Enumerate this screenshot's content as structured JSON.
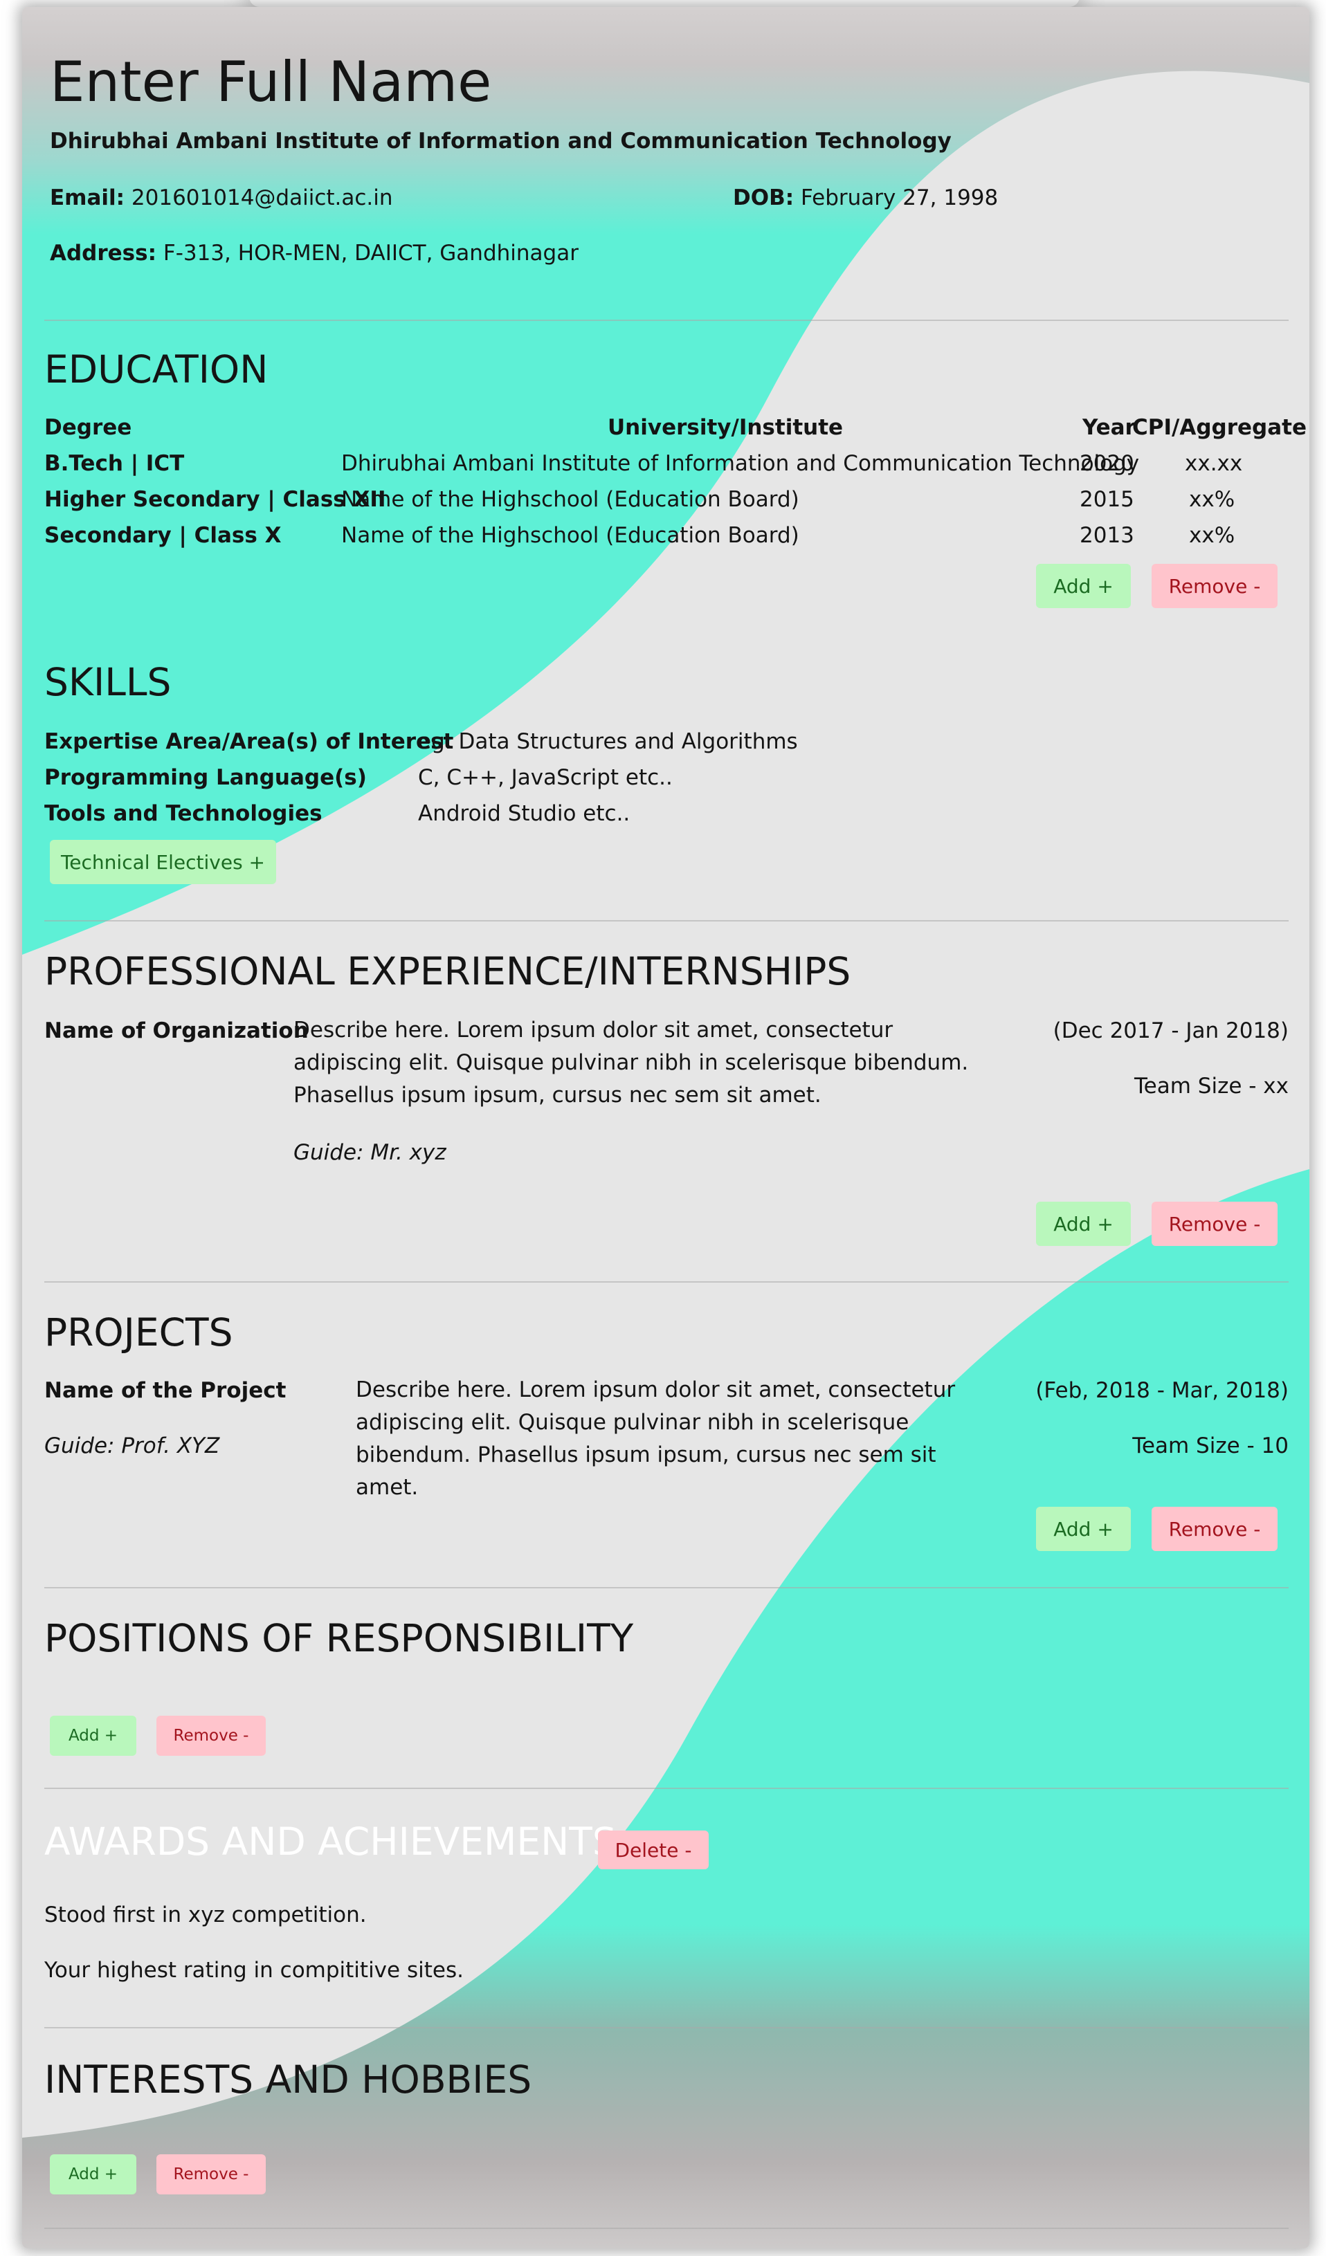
{
  "header": {
    "name": "Enter Full Name",
    "institute": "Dhirubhai Ambani Institute of Information and Communication Technology",
    "email_label": "Email:",
    "email": "201601014@daiict.ac.in",
    "dob_label": "DOB:",
    "dob": "February 27, 1998",
    "address_label": "Address:",
    "address": "F-313, HOR-MEN, DAIICT, Gandhinagar"
  },
  "education": {
    "title": "EDUCATION",
    "headers": [
      "Degree",
      "University/Institute",
      "Year",
      "CPI/Aggregate"
    ],
    "rows": [
      {
        "degree": "B.Tech | ICT",
        "institute": "Dhirubhai Ambani Institute of Information and Communication Technology",
        "year": "2020",
        "score": "xx.xx"
      },
      {
        "degree": "Higher Secondary | Class XII",
        "institute": "Name of the Highschool (Education Board)",
        "year": "2015",
        "score": "xx%"
      },
      {
        "degree": "Secondary | Class X",
        "institute": "Name of the Highschool (Education Board)",
        "year": "2013",
        "score": "xx%"
      }
    ],
    "add_label": "Add +",
    "remove_label": "Remove -"
  },
  "skills": {
    "title": "SKILLS",
    "rows": [
      {
        "label": "Expertise Area/Area(s) of Interest",
        "value": "eg. Data Structures and Algorithms"
      },
      {
        "label": "Programming Language(s)",
        "value": "C, C++, JavaScript etc.."
      },
      {
        "label": "Tools and Technologies",
        "value": "Android Studio etc.."
      }
    ],
    "electives_label": "Technical Electives +"
  },
  "experience": {
    "title": "PROFESSIONAL EXPERIENCE/INTERNSHIPS",
    "org": "Name of Organization",
    "description": "Describe here. Lorem ipsum dolor sit amet, consectetur adipiscing elit. Quisque pulvinar nibh in scelerisque bibendum. Phasellus ipsum ipsum, cursus nec sem sit amet.",
    "guide": "Guide: Mr. xyz",
    "dates": "(Dec 2017 - Jan 2018)",
    "team": "Team Size - xx",
    "add_label": "Add +",
    "remove_label": "Remove -"
  },
  "projects": {
    "title": "PROJECTS",
    "name": "Name of the Project",
    "guide": "Guide: Prof. XYZ",
    "description": "Describe here. Lorem ipsum dolor sit amet, consectetur adipiscing elit. Quisque pulvinar nibh in scelerisque bibendum. Phasellus ipsum ipsum, cursus nec sem sit amet.",
    "dates": "(Feb, 2018 - Mar, 2018)",
    "team": "Team Size - 10",
    "add_label": "Add +",
    "remove_label": "Remove -"
  },
  "positions": {
    "title": "POSITIONS OF RESPONSIBILITY",
    "add_label": "Add +",
    "remove_label": "Remove -"
  },
  "awards": {
    "title": "AWARDS AND ACHIEVEMENTS",
    "delete_label": "Delete -",
    "items": [
      "Stood first in xyz competition.",
      "Your highest rating in compititive sites."
    ]
  },
  "interests": {
    "title": "INTERESTS AND HOBBIES",
    "add_label": "Add +",
    "remove_label": "Remove -"
  },
  "colors": {
    "paper": "#e6e6e6",
    "wave_teal": "#5ef0d6",
    "add_bg": "#b9f7bc",
    "add_text": "#1b6b22",
    "remove_bg": "#ffc4cc",
    "remove_text": "#a3141e"
  }
}
